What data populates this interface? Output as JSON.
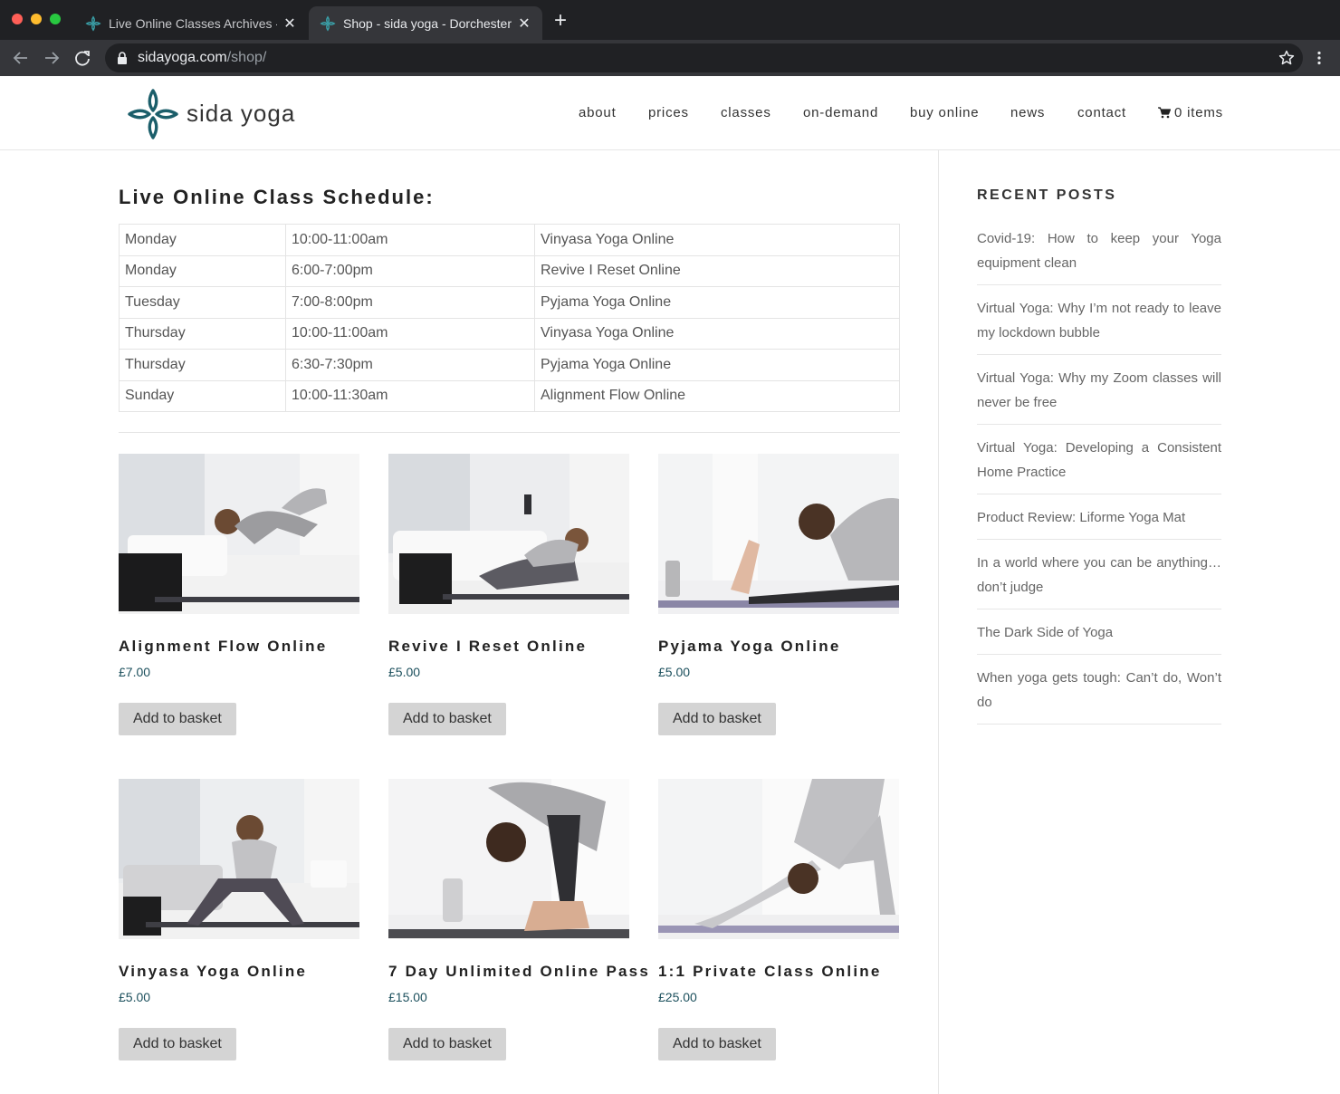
{
  "browser": {
    "tabs": [
      {
        "title": "Live Online Classes Archives -"
      },
      {
        "title": "Shop - sida yoga - Dorchester,"
      }
    ],
    "close_glyph": "✕",
    "new_tab_glyph": "+",
    "url_host": "sidayoga.com",
    "url_path": "/shop/"
  },
  "site": {
    "logo_text": "sida yoga",
    "brand_color": "#1b5e6a",
    "nav": [
      {
        "label": "about"
      },
      {
        "label": "prices"
      },
      {
        "label": "classes"
      },
      {
        "label": "on-demand"
      },
      {
        "label": "buy online"
      },
      {
        "label": "news"
      },
      {
        "label": "contact"
      }
    ],
    "cart_label": "0 items"
  },
  "schedule": {
    "title": "Live Online Class Schedule:",
    "rows": [
      {
        "day": "Monday",
        "time": "10:00-11:00am",
        "class": "Vinyasa Yoga Online"
      },
      {
        "day": "Monday",
        "time": "6:00-7:00pm",
        "class": "Revive I Reset Online"
      },
      {
        "day": "Tuesday",
        "time": "7:00-8:00pm",
        "class": "Pyjama Yoga Online"
      },
      {
        "day": "Thursday",
        "time": "10:00-11:00am",
        "class": "Vinyasa Yoga Online"
      },
      {
        "day": "Thursday",
        "time": "6:30-7:30pm",
        "class": "Pyjama Yoga Online"
      },
      {
        "day": "Sunday",
        "time": "10:00-11:30am",
        "class": "Alignment Flow Online"
      }
    ]
  },
  "products": [
    {
      "name": "Alignment Flow Online",
      "price": "£7.00",
      "button": "Add to basket"
    },
    {
      "name": "Revive I Reset Online",
      "price": "£5.00",
      "button": "Add to basket"
    },
    {
      "name": "Pyjama Yoga Online",
      "price": "£5.00",
      "button": "Add to basket"
    },
    {
      "name": "Vinyasa Yoga Online",
      "price": "£5.00",
      "button": "Add to basket"
    },
    {
      "name": "7 Day Unlimited Online Pass",
      "price": "£15.00",
      "button": "Add to basket"
    },
    {
      "name": "1:1 Private Class Online",
      "price": "£25.00",
      "button": "Add to basket"
    }
  ],
  "sidebar": {
    "title": "RECENT POSTS",
    "posts": [
      {
        "title": "Covid-19: How to keep your Yoga equipment clean"
      },
      {
        "title": "Virtual Yoga: Why I’m not ready to leave my lockdown bubble"
      },
      {
        "title": "Virtual Yoga: Why my Zoom classes will never be free"
      },
      {
        "title": "Virtual Yoga: Developing a Consistent Home Practice"
      },
      {
        "title": "Product Review: Liforme Yoga Mat"
      },
      {
        "title": "In a world where you can be anything… don’t judge"
      },
      {
        "title": "The Dark Side of Yoga"
      },
      {
        "title": "When yoga gets tough: Can’t do, Won’t do"
      }
    ]
  }
}
